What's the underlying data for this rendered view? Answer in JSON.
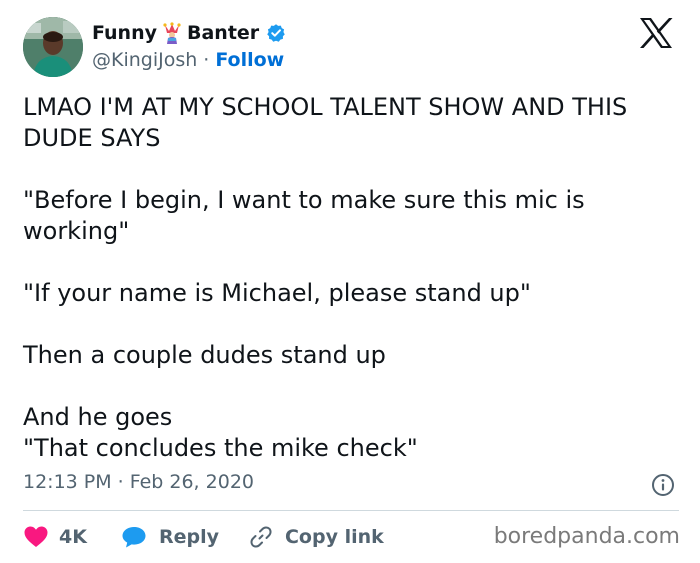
{
  "user": {
    "display_name": "Funny",
    "display_name_suffix": "Banter",
    "emoji_icon": "jester-emoji",
    "verified_icon": "verified-badge-icon",
    "handle": "@KingiJosh",
    "separator": "·",
    "follow_label": "Follow"
  },
  "tweet": {
    "lines": [
      "LMAO I'M AT MY SCHOOL TALENT SHOW AND THIS DUDE SAYS",
      "\"Before I begin, I want to make sure this mic is working\"",
      "\"If your name is Michael, please stand up\"",
      "Then a couple dudes stand up",
      "And he goes",
      "\"That concludes the mike check\""
    ],
    "time": "12:13 PM",
    "date": "Feb 26, 2020",
    "meta_separator": "·"
  },
  "actions": {
    "like_count": "4K",
    "reply_label": "Reply",
    "copy_link_label": "Copy link"
  },
  "watermark": "boredpanda.com",
  "colors": {
    "like": "#f91880",
    "reply": "#1d9bf0",
    "follow": "#006fd6",
    "verified": "#1d9bf0",
    "muted": "#536471"
  }
}
